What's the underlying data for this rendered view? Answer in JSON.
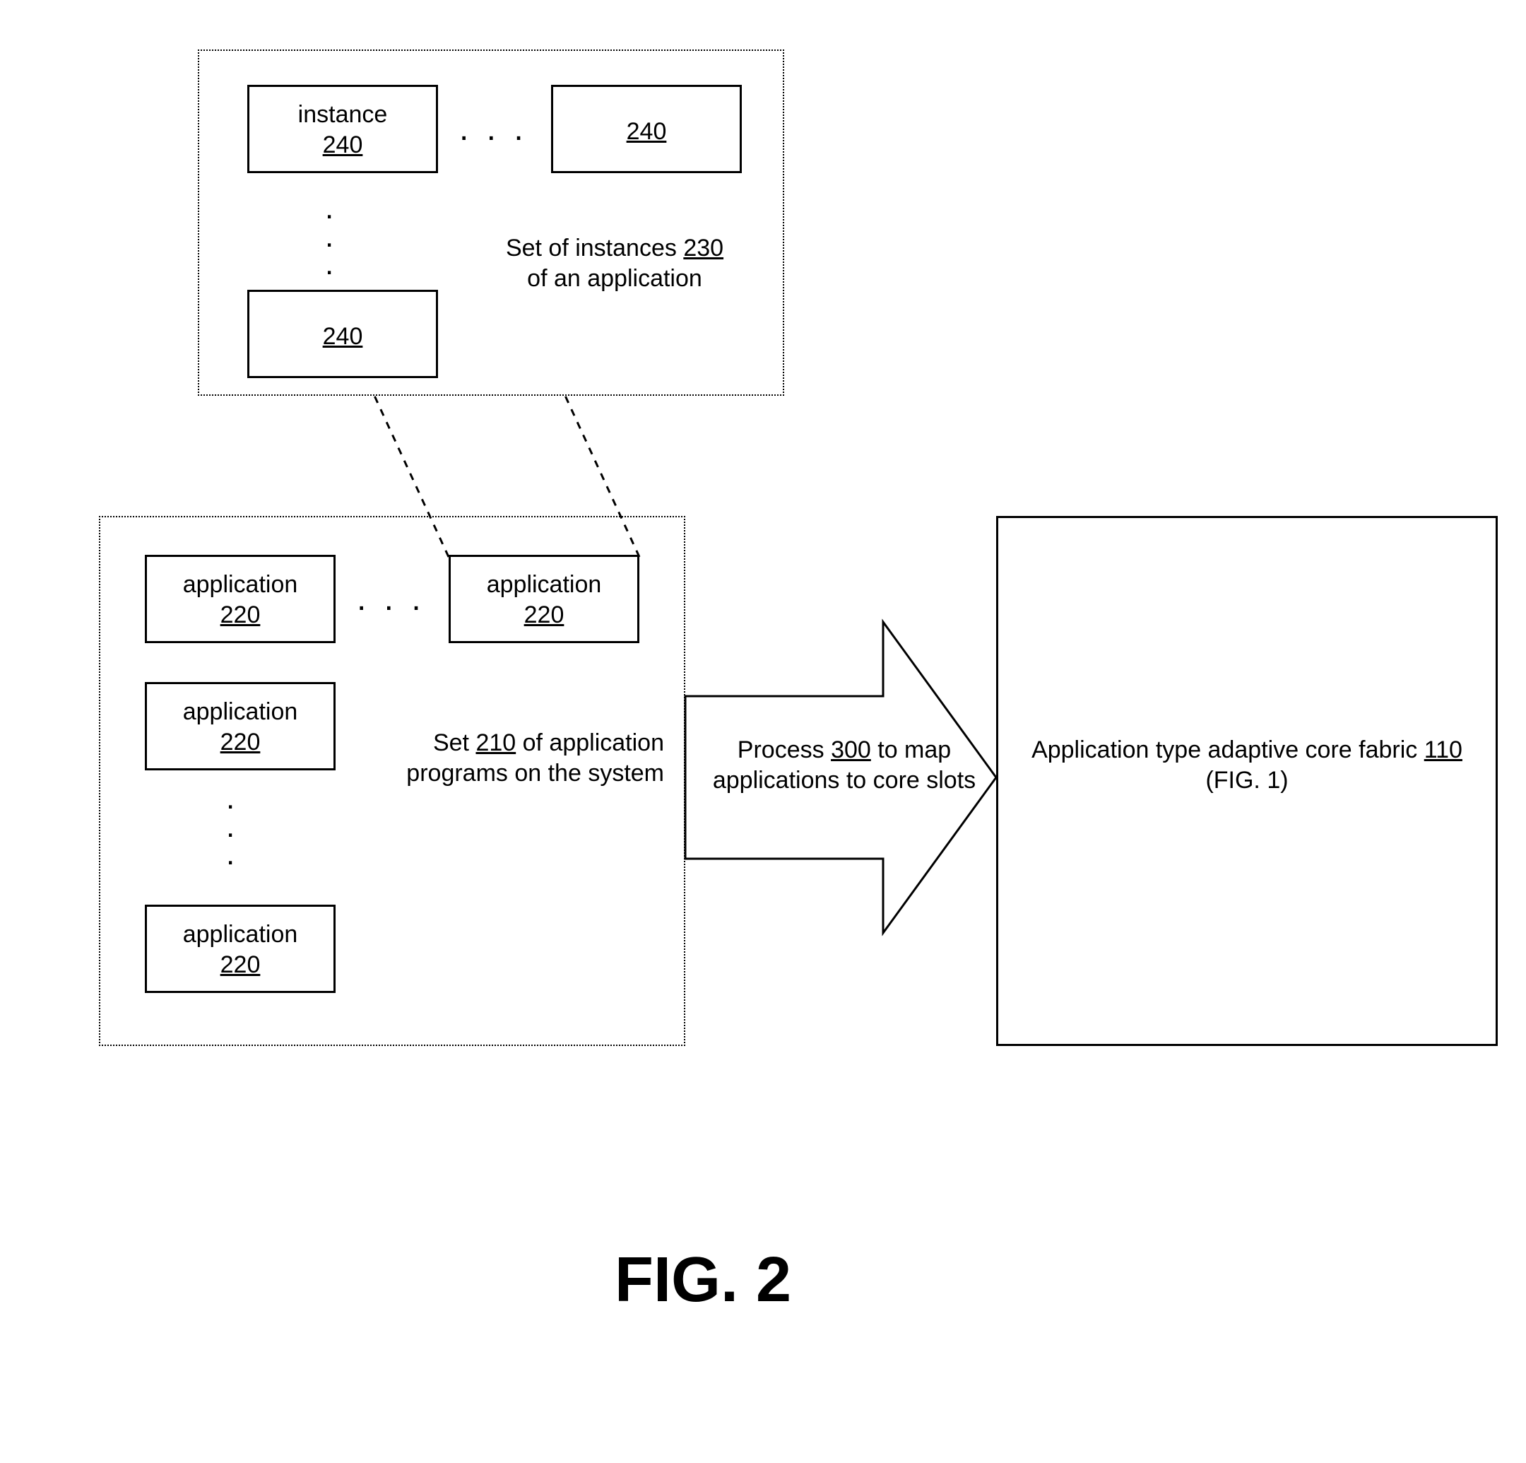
{
  "fig_label": "FIG. 2",
  "top_box": {
    "caption_prefix": "Set of instances ",
    "caption_ref": "230",
    "caption_suffix": " of an application",
    "b1_label": "instance",
    "b1_ref": "240",
    "b2_ref": "240",
    "b3_ref": "240"
  },
  "mid_box": {
    "caption_prefix": "Set ",
    "caption_ref": "210",
    "caption_mid": " of application programs on the system",
    "app_label": "application",
    "app_ref": "220"
  },
  "arrow": {
    "line1_prefix": "Process ",
    "line1_ref": "300",
    "line1_suffix": " to map",
    "line2": "applications to core slots"
  },
  "right_box": {
    "line1": "Application type adaptive core fabric  ",
    "ref": "110",
    "line2": "(FIG. 1)"
  }
}
